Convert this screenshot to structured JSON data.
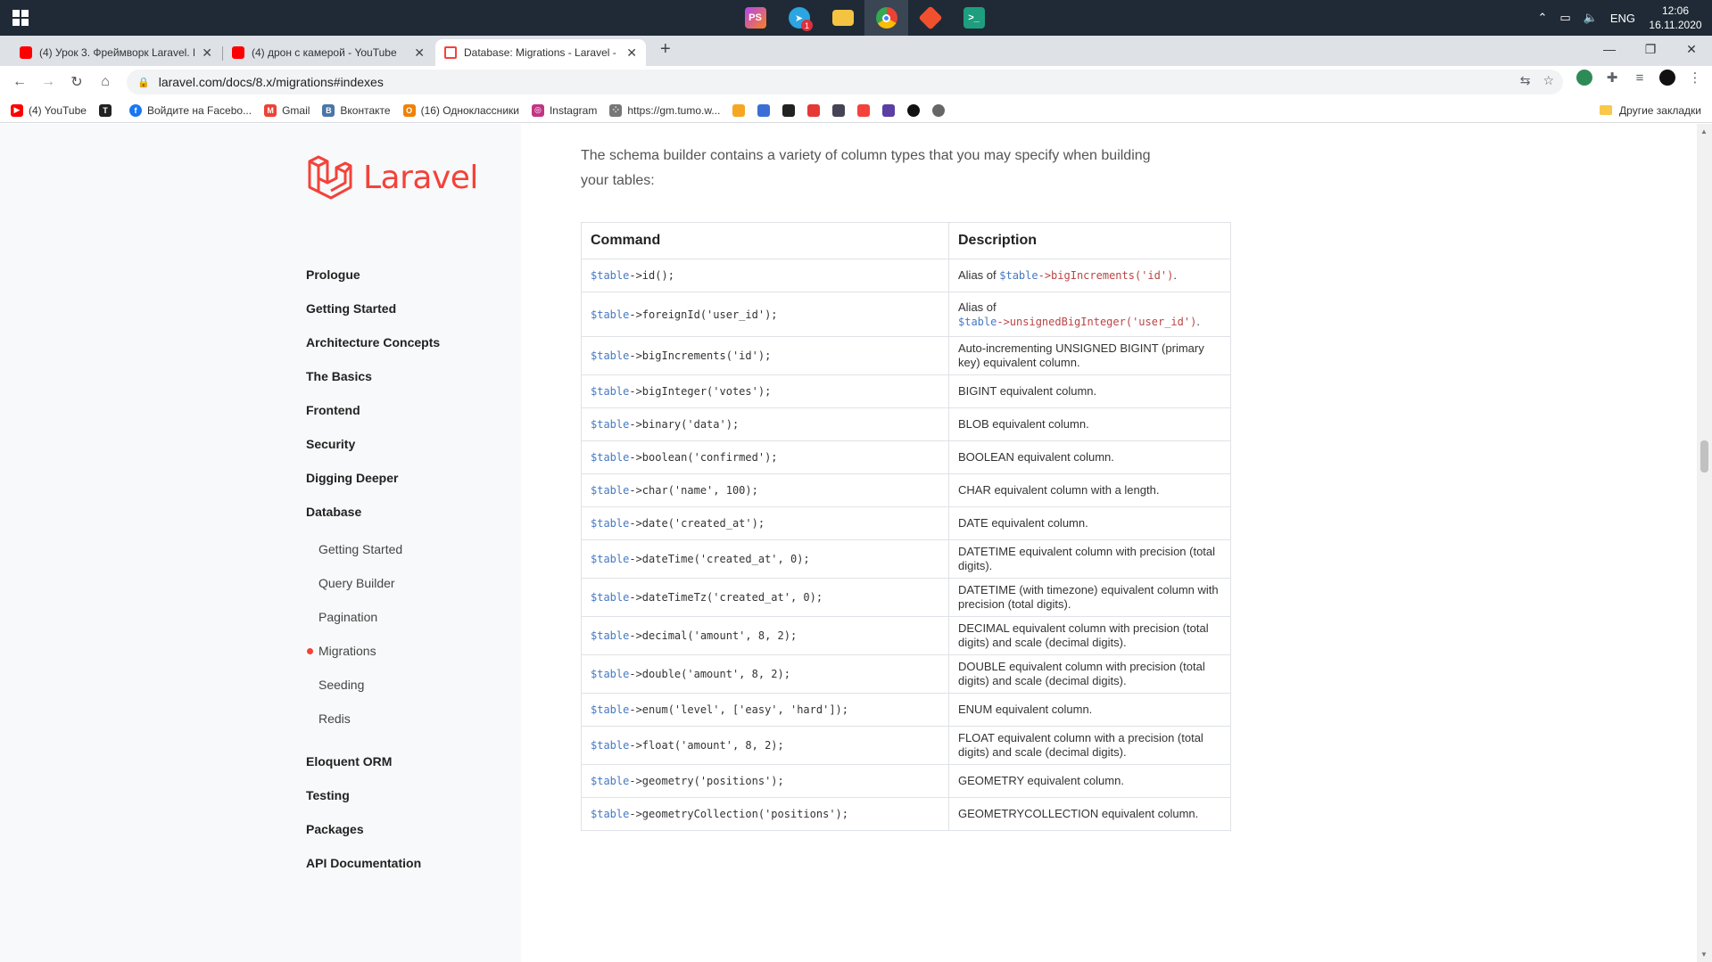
{
  "taskbar": {
    "time": "12:06",
    "date": "16.11.2020",
    "lang": "ENG",
    "telegram_badge": "1"
  },
  "tabs": [
    {
      "title": "(4) Урок 3. Фреймворк Laravel. E",
      "close": "✕"
    },
    {
      "title": "(4) дрон с камерой - YouTube",
      "close": "✕"
    },
    {
      "title": "Database: Migrations - Laravel -",
      "close": "✕"
    }
  ],
  "new_tab": "+",
  "window_controls": {
    "minimize": "—",
    "maximize": "❐",
    "close": "✕"
  },
  "toolbar": {
    "url": "laravel.com/docs/8.x/migrations#indexes"
  },
  "bookmarks": [
    {
      "label": "(4) YouTube",
      "color": "#ff0000",
      "glyph": "▶"
    },
    {
      "label": "",
      "color": "#222222",
      "glyph": "T"
    },
    {
      "label": "Войдите на Facebo...",
      "color": "#1877f2",
      "glyph": "f"
    },
    {
      "label": "Gmail",
      "color": "#ea4335",
      "glyph": "M"
    },
    {
      "label": "Вконтакте",
      "color": "#4a76a8",
      "glyph": "В"
    },
    {
      "label": "(16) Одноклассники",
      "color": "#ee8208",
      "glyph": "О"
    },
    {
      "label": "Instagram",
      "color": "#c13584",
      "glyph": "◎"
    },
    {
      "label": "https://gm.tumo.w...",
      "color": "#555555",
      "glyph": "⁘"
    }
  ],
  "bookmarks_other": "Другие закладки",
  "sidebar": {
    "logo": "Laravel",
    "top_items": [
      "Prologue",
      "Getting Started",
      "Architecture Concepts",
      "The Basics",
      "Frontend",
      "Security",
      "Digging Deeper",
      "Database"
    ],
    "sub_items": [
      "Getting Started",
      "Query Builder",
      "Pagination",
      "Migrations",
      "Seeding",
      "Redis"
    ],
    "active_sub": "Migrations",
    "bottom_items": [
      "Eloquent ORM",
      "Testing",
      "Packages",
      "API Documentation"
    ]
  },
  "content": {
    "intro": "The schema builder contains a variety of column types that you may specify when building your tables:",
    "headers": {
      "command": "Command",
      "description": "Description"
    },
    "rows": [
      {
        "var": "$table",
        "code": "->id();",
        "desc": "Alias of ",
        "desc_var": "$table",
        "desc_code": "->bigIncrements('id')",
        "desc_tail": ".",
        "h": 37
      },
      {
        "var": "$table",
        "code": "->foreignId('user_id');",
        "desc": "Alias of",
        "desc_var": "$table",
        "desc_code": "->unsignedBigInteger('user_id')",
        "desc_tail": ".",
        "h": 50,
        "desc_break": true
      },
      {
        "var": "$table",
        "code": "->bigIncrements('id');",
        "desc": "Auto-incrementing UNSIGNED BIGINT (primary key) equivalent column.",
        "h": 43
      },
      {
        "var": "$table",
        "code": "->bigInteger('votes');",
        "desc": "BIGINT equivalent column.",
        "h": 37
      },
      {
        "var": "$table",
        "code": "->binary('data');",
        "desc": "BLOB equivalent column.",
        "h": 37
      },
      {
        "var": "$table",
        "code": "->boolean('confirmed');",
        "desc": "BOOLEAN equivalent column.",
        "h": 37
      },
      {
        "var": "$table",
        "code": "->char('name', 100);",
        "desc": "CHAR equivalent column with a length.",
        "h": 37
      },
      {
        "var": "$table",
        "code": "->date('created_at');",
        "desc": "DATE equivalent column.",
        "h": 37
      },
      {
        "var": "$table",
        "code": "->dateTime('created_at', 0);",
        "desc": "DATETIME equivalent column with precision (total digits).",
        "h": 43
      },
      {
        "var": "$table",
        "code": "->dateTimeTz('created_at', 0);",
        "desc": "DATETIME (with timezone) equivalent column with precision (total digits).",
        "h": 43
      },
      {
        "var": "$table",
        "code": "->decimal('amount', 8, 2);",
        "desc": "DECIMAL equivalent column with precision (total digits) and scale (decimal digits).",
        "h": 43
      },
      {
        "var": "$table",
        "code": "->double('amount', 8, 2);",
        "desc": "DOUBLE equivalent column with precision (total digits) and scale (decimal digits).",
        "h": 43
      },
      {
        "var": "$table",
        "code": "->enum('level', ['easy', 'hard']);",
        "desc": "ENUM equivalent column.",
        "h": 37
      },
      {
        "var": "$table",
        "code": "->float('amount', 8, 2);",
        "desc": "FLOAT equivalent column with a precision (total digits) and scale (decimal digits).",
        "h": 43
      },
      {
        "var": "$table",
        "code": "->geometry('positions');",
        "desc": "GEOMETRY equivalent column.",
        "h": 37
      },
      {
        "var": "$table",
        "code": "->geometryCollection('positions');",
        "desc": "GEOMETRYCOLLECTION equivalent column.",
        "h": 37
      }
    ]
  }
}
